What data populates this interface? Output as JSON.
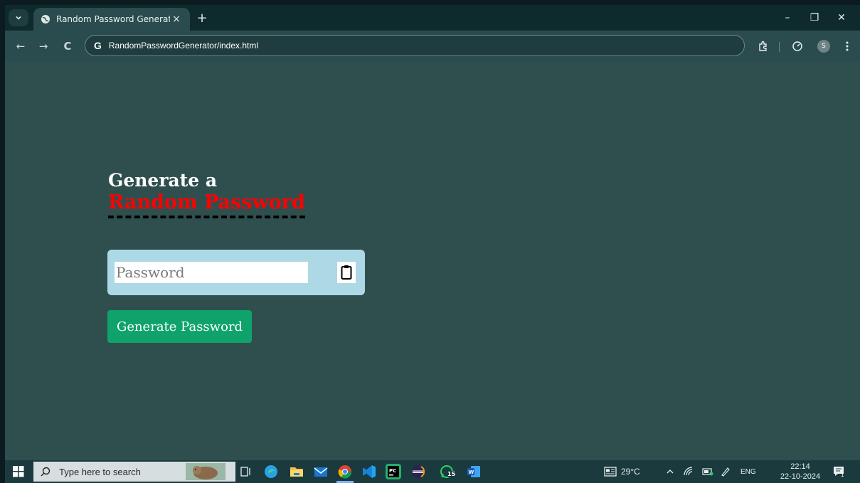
{
  "browser": {
    "tab_title": "Random Password Generator",
    "tab_close": "×",
    "new_tab": "+",
    "url": "RandomPasswordGenerator/index.html",
    "omnibox_icon": "G",
    "profile_initial": "S",
    "window_controls": {
      "minimize": "–",
      "restore": "❐",
      "close": "✕"
    },
    "nav": {
      "back": "←",
      "forward": "→",
      "reload": "C"
    }
  },
  "page": {
    "heading_line1": "Generate a",
    "heading_line2": "Random Password",
    "password_placeholder": "Password",
    "generate_button": "Generate Password",
    "colors": {
      "background": "#2f4f4f",
      "accent_red": "#ff0000",
      "input_panel": "#add8e6",
      "button": "#0fa36b"
    }
  },
  "taskbar": {
    "search_placeholder": "Type here to search",
    "weather": "29°C",
    "language": "ENG",
    "time": "22:14",
    "date": "22-10-2024",
    "whatsapp_badge": "15",
    "notification_badge": "1"
  }
}
